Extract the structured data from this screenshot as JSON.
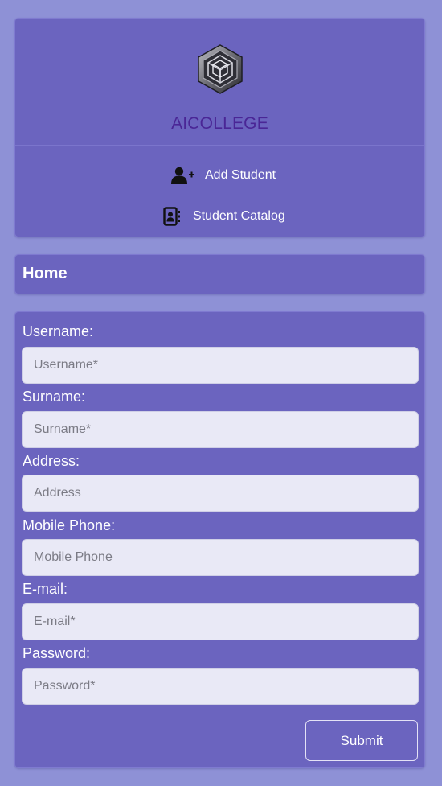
{
  "brand": {
    "name": "AICOLLEGE",
    "logo_icon": "hexagon-cube-logo"
  },
  "nav": {
    "items": [
      {
        "label": "Add Student",
        "icon": "add-user-icon"
      },
      {
        "label": "Student Catalog",
        "icon": "contact-book-icon"
      }
    ]
  },
  "breadcrumb": {
    "title": "Home"
  },
  "form": {
    "fields": [
      {
        "label": "Username:",
        "placeholder": "Username*",
        "value": ""
      },
      {
        "label": "Surname:",
        "placeholder": "Surname*",
        "value": ""
      },
      {
        "label": "Address:",
        "placeholder": "Address",
        "value": ""
      },
      {
        "label": "Mobile Phone:",
        "placeholder": "Mobile Phone",
        "value": ""
      },
      {
        "label": "E-mail:",
        "placeholder": "E-mail*",
        "value": ""
      },
      {
        "label": "Password:",
        "placeholder": "Password*",
        "value": ""
      }
    ],
    "submit_label": "Submit"
  },
  "colors": {
    "page_background": "#8e91d6",
    "card_background": "#6b64bf",
    "brand_text": "#4a2696",
    "input_background": "#e9e9f6"
  }
}
